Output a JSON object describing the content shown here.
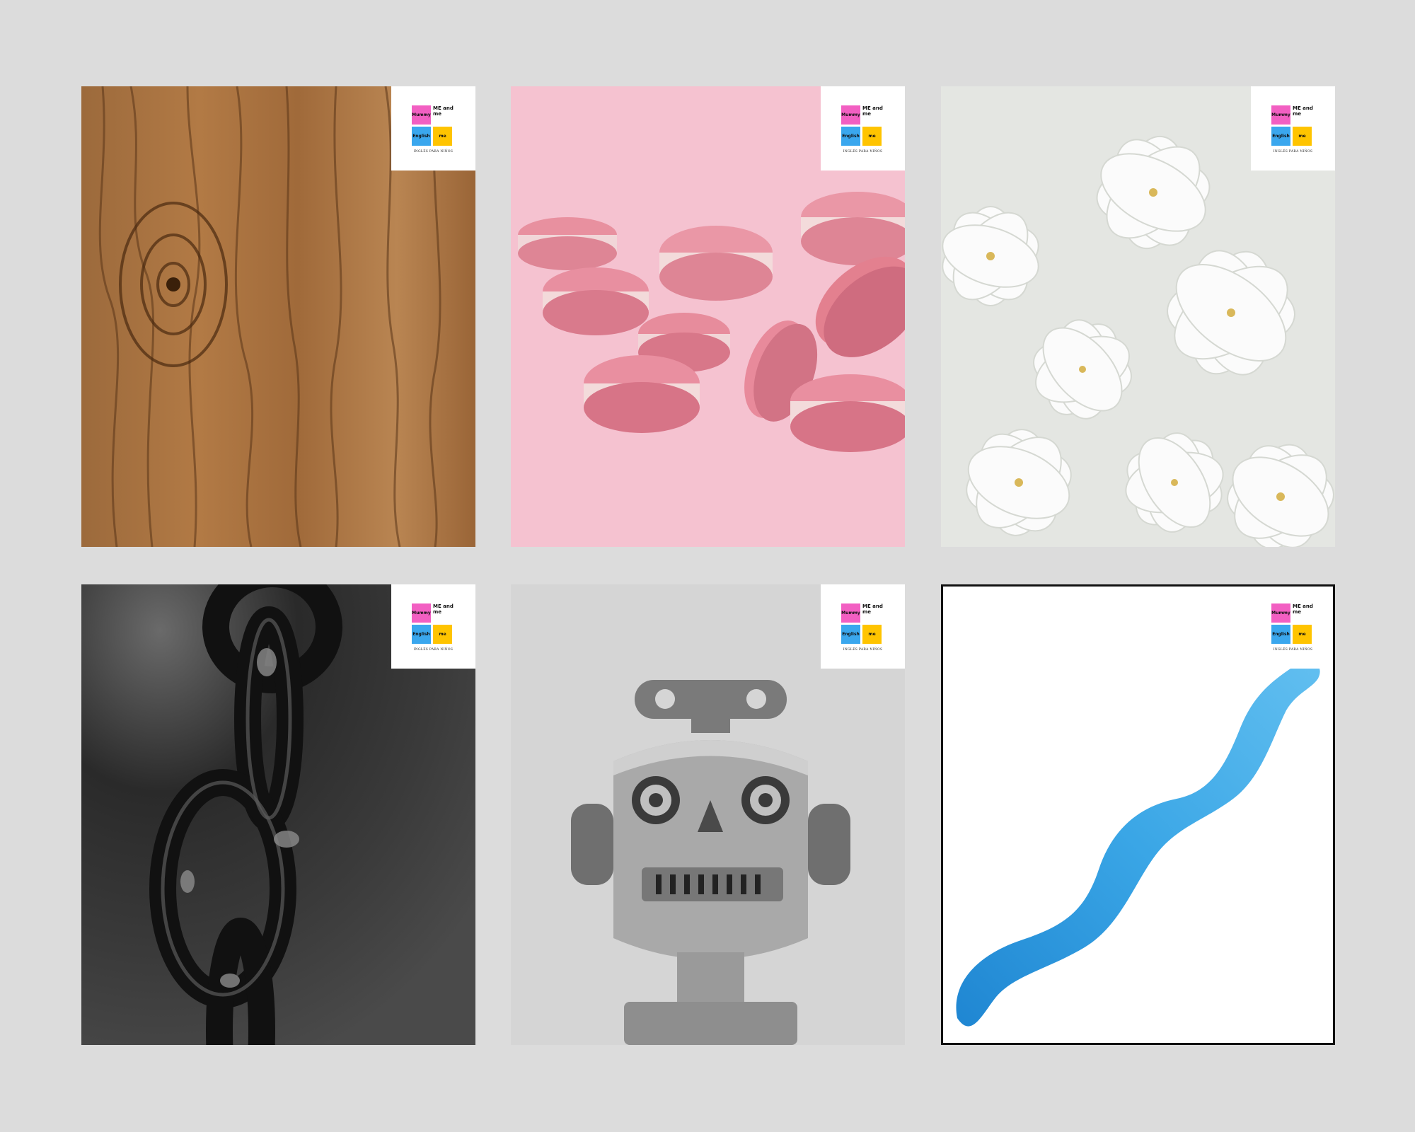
{
  "cards": [
    {
      "subject": "wood-texture"
    },
    {
      "subject": "pink-macarons"
    },
    {
      "subject": "white-flowers"
    },
    {
      "subject": "black-chain"
    },
    {
      "subject": "toy-robot"
    },
    {
      "subject": "blue-watercolor-wave"
    }
  ],
  "logo": {
    "word_mummy": "Mummy",
    "word_me_and_me": "ME and me",
    "word_english": "English",
    "word_me": "me",
    "tagline": "INGLÉS PARA NIÑOS"
  },
  "colors": {
    "background": "#dcdcdc",
    "logo_pink": "#f25fc2",
    "logo_blue": "#3aa7ee",
    "logo_yellow": "#ffc400",
    "wave_blue": "#2b8fd6"
  }
}
